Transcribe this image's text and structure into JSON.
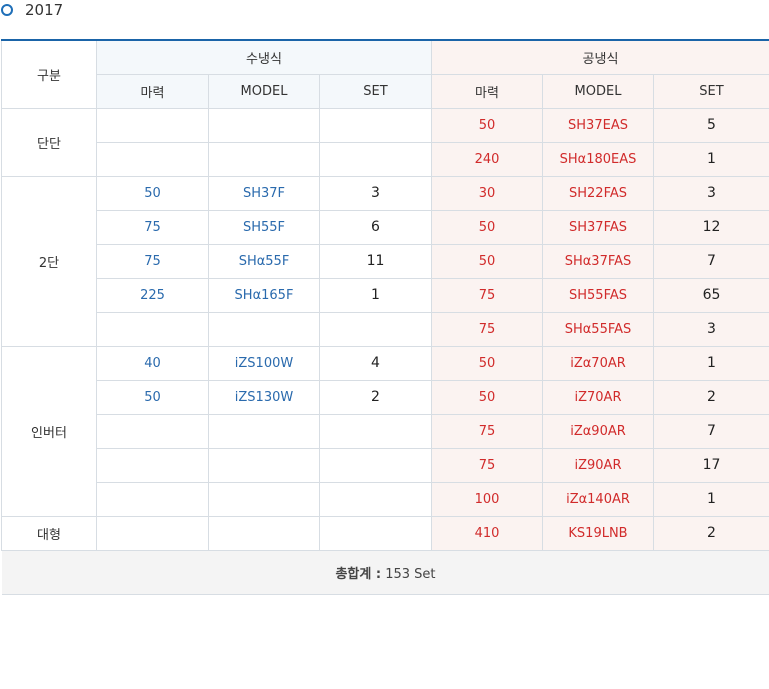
{
  "year": "2017",
  "table": {
    "col_gubun": "구분",
    "group_water": "수냉식",
    "group_air": "공냉식",
    "sub_headers": {
      "power": "마력",
      "model": "MODEL",
      "set": "SET"
    },
    "categories": {
      "single": "단단",
      "two": "2단",
      "inverter": "인버터",
      "large": "대형"
    },
    "rows": [
      {
        "water": {
          "power": "",
          "model": "",
          "set": ""
        },
        "air": {
          "power": "50",
          "model": "SH37EAS",
          "set": "5"
        }
      },
      {
        "water": {
          "power": "",
          "model": "",
          "set": ""
        },
        "air": {
          "power": "240",
          "model": "SHα180EAS",
          "set": "1"
        }
      },
      {
        "water": {
          "power": "50",
          "model": "SH37F",
          "set": "3"
        },
        "air": {
          "power": "30",
          "model": "SH22FAS",
          "set": "3"
        }
      },
      {
        "water": {
          "power": "75",
          "model": "SH55F",
          "set": "6"
        },
        "air": {
          "power": "50",
          "model": "SH37FAS",
          "set": "12"
        }
      },
      {
        "water": {
          "power": "75",
          "model": "SHα55F",
          "set": "11"
        },
        "air": {
          "power": "50",
          "model": "SHα37FAS",
          "set": "7"
        }
      },
      {
        "water": {
          "power": "225",
          "model": "SHα165F",
          "set": "1"
        },
        "air": {
          "power": "75",
          "model": "SH55FAS",
          "set": "65"
        }
      },
      {
        "water": {
          "power": "",
          "model": "",
          "set": ""
        },
        "air": {
          "power": "75",
          "model": "SHα55FAS",
          "set": "3"
        }
      },
      {
        "water": {
          "power": "40",
          "model": "iZS100W",
          "set": "4"
        },
        "air": {
          "power": "50",
          "model": "iZα70AR",
          "set": "1"
        }
      },
      {
        "water": {
          "power": "50",
          "model": "iZS130W",
          "set": "2"
        },
        "air": {
          "power": "50",
          "model": "iZ70AR",
          "set": "2"
        }
      },
      {
        "water": {
          "power": "",
          "model": "",
          "set": ""
        },
        "air": {
          "power": "75",
          "model": "iZα90AR",
          "set": "7"
        }
      },
      {
        "water": {
          "power": "",
          "model": "",
          "set": ""
        },
        "air": {
          "power": "75",
          "model": "iZ90AR",
          "set": "17"
        }
      },
      {
        "water": {
          "power": "",
          "model": "",
          "set": ""
        },
        "air": {
          "power": "100",
          "model": "iZα140AR",
          "set": "1"
        }
      },
      {
        "water": {
          "power": "",
          "model": "",
          "set": ""
        },
        "air": {
          "power": "410",
          "model": "KS19LNB",
          "set": "2"
        }
      }
    ],
    "total": {
      "label": "총합계 :",
      "value": "153 Set"
    }
  },
  "colors": {
    "water_text": "#2a6aad",
    "air_text": "#d12b2b",
    "air_bg": "#fbf3f1",
    "header_rule": "#1a64a8"
  }
}
